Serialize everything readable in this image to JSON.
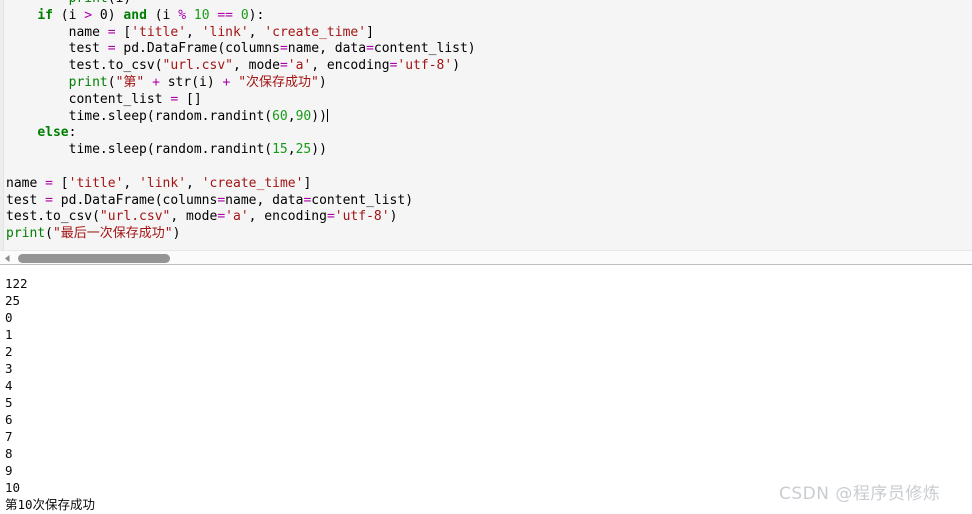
{
  "editor": {
    "name": "python-code-editor",
    "background_color": "#f5f5f5",
    "syntax_colors": {
      "keyword": "#007f00",
      "builtin": "#007f00",
      "string": "#a31515",
      "number": "#1a9a1a",
      "operator": "#aa00aa",
      "plain": "#000000"
    },
    "lines": [
      {
        "id": "line-print-i",
        "segments": [
          {
            "t": "        ",
            "c": "plain"
          },
          {
            "t": "print",
            "c": "builtin"
          },
          {
            "t": "(i)",
            "c": "plain"
          }
        ]
      },
      {
        "id": "line-if",
        "segments": [
          {
            "t": "    ",
            "c": "plain"
          },
          {
            "t": "if",
            "c": "kw"
          },
          {
            "t": " (i ",
            "c": "plain"
          },
          {
            "t": ">",
            "c": "op"
          },
          {
            "t": " 0) ",
            "c": "plain"
          },
          {
            "t": "and",
            "c": "kw"
          },
          {
            "t": " (i ",
            "c": "plain"
          },
          {
            "t": "%",
            "c": "op"
          },
          {
            "t": " ",
            "c": "plain"
          },
          {
            "t": "10",
            "c": "num"
          },
          {
            "t": " ",
            "c": "plain"
          },
          {
            "t": "==",
            "c": "op"
          },
          {
            "t": " ",
            "c": "plain"
          },
          {
            "t": "0",
            "c": "num"
          },
          {
            "t": "):",
            "c": "plain"
          }
        ]
      },
      {
        "id": "line-name",
        "segments": [
          {
            "t": "        name ",
            "c": "plain"
          },
          {
            "t": "=",
            "c": "op"
          },
          {
            "t": " [",
            "c": "plain"
          },
          {
            "t": "'title'",
            "c": "str"
          },
          {
            "t": ", ",
            "c": "plain"
          },
          {
            "t": "'link'",
            "c": "str"
          },
          {
            "t": ", ",
            "c": "plain"
          },
          {
            "t": "'create_time'",
            "c": "str"
          },
          {
            "t": "]",
            "c": "plain"
          }
        ]
      },
      {
        "id": "line-test-df",
        "segments": [
          {
            "t": "        test ",
            "c": "plain"
          },
          {
            "t": "=",
            "c": "op"
          },
          {
            "t": " pd.DataFrame(columns",
            "c": "plain"
          },
          {
            "t": "=",
            "c": "op"
          },
          {
            "t": "name, data",
            "c": "plain"
          },
          {
            "t": "=",
            "c": "op"
          },
          {
            "t": "content_list)",
            "c": "plain"
          }
        ]
      },
      {
        "id": "line-to-csv",
        "segments": [
          {
            "t": "        test.to_csv(",
            "c": "plain"
          },
          {
            "t": "\"url.csv\"",
            "c": "str"
          },
          {
            "t": ", mode",
            "c": "plain"
          },
          {
            "t": "=",
            "c": "op"
          },
          {
            "t": "'a'",
            "c": "str"
          },
          {
            "t": ", encoding",
            "c": "plain"
          },
          {
            "t": "=",
            "c": "op"
          },
          {
            "t": "'utf-8'",
            "c": "str"
          },
          {
            "t": ")",
            "c": "plain"
          }
        ]
      },
      {
        "id": "line-print-save",
        "segments": [
          {
            "t": "        ",
            "c": "plain"
          },
          {
            "t": "print",
            "c": "builtin"
          },
          {
            "t": "(",
            "c": "plain"
          },
          {
            "t": "\"第\"",
            "c": "str"
          },
          {
            "t": " ",
            "c": "plain"
          },
          {
            "t": "+",
            "c": "op"
          },
          {
            "t": " str(i) ",
            "c": "plain"
          },
          {
            "t": "+",
            "c": "op"
          },
          {
            "t": " ",
            "c": "plain"
          },
          {
            "t": "\"次保存成功\"",
            "c": "str"
          },
          {
            "t": ")",
            "c": "plain"
          }
        ]
      },
      {
        "id": "line-content-reset",
        "segments": [
          {
            "t": "        content_list ",
            "c": "plain"
          },
          {
            "t": "=",
            "c": "op"
          },
          {
            "t": " []",
            "c": "plain"
          }
        ]
      },
      {
        "id": "line-sleep-long",
        "segments": [
          {
            "t": "        time.sleep(random.randint(",
            "c": "plain"
          },
          {
            "t": "60",
            "c": "num"
          },
          {
            "t": ",",
            "c": "plain"
          },
          {
            "t": "90",
            "c": "num"
          },
          {
            "t": "))",
            "c": "plain"
          }
        ],
        "caret": true
      },
      {
        "id": "line-else",
        "segments": [
          {
            "t": "    ",
            "c": "plain"
          },
          {
            "t": "else",
            "c": "kw"
          },
          {
            "t": ":",
            "c": "plain"
          }
        ]
      },
      {
        "id": "line-sleep-short",
        "segments": [
          {
            "t": "        time.sleep(random.randint(",
            "c": "plain"
          },
          {
            "t": "15",
            "c": "num"
          },
          {
            "t": ",",
            "c": "plain"
          },
          {
            "t": "25",
            "c": "num"
          },
          {
            "t": "))",
            "c": "plain"
          }
        ]
      },
      {
        "id": "line-blank-1",
        "segments": [
          {
            "t": " ",
            "c": "plain"
          }
        ]
      },
      {
        "id": "line-name-2",
        "segments": [
          {
            "t": "name ",
            "c": "plain"
          },
          {
            "t": "=",
            "c": "op"
          },
          {
            "t": " [",
            "c": "plain"
          },
          {
            "t": "'title'",
            "c": "str"
          },
          {
            "t": ", ",
            "c": "plain"
          },
          {
            "t": "'link'",
            "c": "str"
          },
          {
            "t": ", ",
            "c": "plain"
          },
          {
            "t": "'create_time'",
            "c": "str"
          },
          {
            "t": "]",
            "c": "plain"
          }
        ]
      },
      {
        "id": "line-test-df-2",
        "segments": [
          {
            "t": "test ",
            "c": "plain"
          },
          {
            "t": "=",
            "c": "op"
          },
          {
            "t": " pd.DataFrame(columns",
            "c": "plain"
          },
          {
            "t": "=",
            "c": "op"
          },
          {
            "t": "name, data",
            "c": "plain"
          },
          {
            "t": "=",
            "c": "op"
          },
          {
            "t": "content_list)",
            "c": "plain"
          }
        ]
      },
      {
        "id": "line-to-csv-2",
        "segments": [
          {
            "t": "test.to_csv(",
            "c": "plain"
          },
          {
            "t": "\"url.csv\"",
            "c": "str"
          },
          {
            "t": ", mode",
            "c": "plain"
          },
          {
            "t": "=",
            "c": "op"
          },
          {
            "t": "'a'",
            "c": "str"
          },
          {
            "t": ", encoding",
            "c": "plain"
          },
          {
            "t": "=",
            "c": "op"
          },
          {
            "t": "'utf-8'",
            "c": "str"
          },
          {
            "t": ")",
            "c": "plain"
          }
        ]
      },
      {
        "id": "line-print-final",
        "segments": [
          {
            "t": "",
            "c": "plain"
          },
          {
            "t": "print",
            "c": "builtin"
          },
          {
            "t": "(",
            "c": "plain"
          },
          {
            "t": "\"最后一次保存成功\"",
            "c": "str"
          },
          {
            "t": ")",
            "c": "plain"
          }
        ]
      }
    ]
  },
  "scrollbar": {
    "name": "horizontal-scrollbar",
    "left_arrow_icon": "triangle-left-icon",
    "thumb_color": "#959595",
    "track_color": "#fbfbfb"
  },
  "output": {
    "name": "console-output",
    "background_color": "#ffffff",
    "lines": [
      "122",
      "25",
      "0",
      "1",
      "2",
      "3",
      "4",
      "5",
      "6",
      "7",
      "8",
      "9",
      "10",
      "第10次保存成功"
    ]
  },
  "watermark": {
    "text": "CSDN @程序员修炼",
    "color": "#c9cdd2"
  }
}
